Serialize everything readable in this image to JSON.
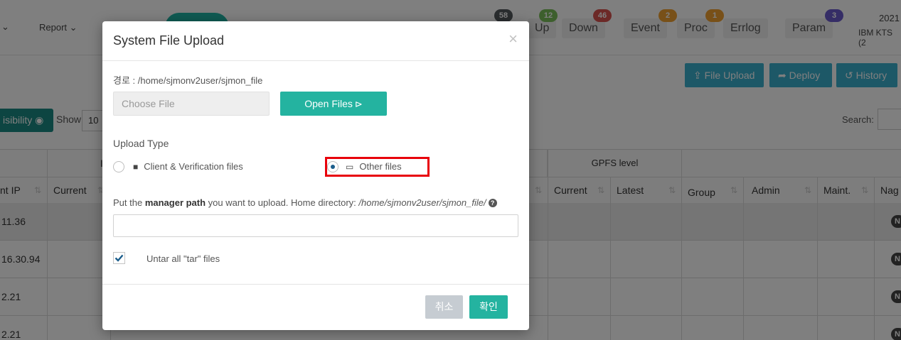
{
  "app": {
    "nav": {
      "chevron_only": "⌄",
      "report_label": "Report ⌄"
    },
    "stats": [
      {
        "label": "Up",
        "count": "12",
        "badge_color": "#7bbf5a"
      },
      {
        "label": "Down",
        "count": "46",
        "badge_color": "#d9534f"
      },
      {
        "label": "Event",
        "count": "2",
        "badge_color": "#f0a030"
      },
      {
        "label": "Proc",
        "count": "1",
        "badge_color": "#f0a030"
      },
      {
        "label": "Errlog",
        "count": "",
        "badge_color": ""
      },
      {
        "label": "Param",
        "count": "3",
        "badge_color": "#6a5acd"
      }
    ],
    "total_badge": "58",
    "header_right": {
      "year": "2021",
      "product": "IBM KTS (2"
    },
    "toolbar": {
      "file_upload": "File Upload",
      "deploy": "Deploy",
      "history": "History"
    },
    "visibility_button": "isibility",
    "show_label": "Show",
    "show_value": "10",
    "search_label": "Search:",
    "table": {
      "group_header_gpfs": "GPFS level",
      "group_header_partial": "I",
      "columns": [
        "nt IP",
        "Current",
        "Current",
        "Latest",
        "Group",
        "Admin",
        "Maint.",
        "Nag"
      ],
      "rows": [
        {
          "ip": "11.36",
          "badge": "N"
        },
        {
          "ip": "16.30.94",
          "badge": "N"
        },
        {
          "ip": "2.21",
          "badge": "N"
        },
        {
          "ip": "2.21",
          "badge": "N"
        }
      ]
    }
  },
  "modal": {
    "title": "System File Upload",
    "close": "×",
    "path_line": "경로 : /home/sjmonv2user/sjmon_file",
    "choose_file_placeholder": "Choose File",
    "open_files_label": "Open Files",
    "upload_type_label": "Upload Type",
    "options": [
      {
        "label": "Client & Verification files",
        "selected": false
      },
      {
        "label": "Other files",
        "selected": true
      }
    ],
    "manager_text_prefix": "Put the ",
    "manager_text_bold": "manager path",
    "manager_text_middle": " you want to upload. Home directory: ",
    "manager_text_path": "/home/sjmonv2user/sjmon_file/",
    "path_input_value": "",
    "untar_label": "Untar all \"tar\" files",
    "untar_checked": true,
    "cancel_label": "취소",
    "ok_label": "확인"
  },
  "colors": {
    "teal": "#24b3a0",
    "toolbar_blue": "#3bb0cf",
    "highlight_red": "#e8000b",
    "cancel_gray": "#c6ccd2"
  }
}
